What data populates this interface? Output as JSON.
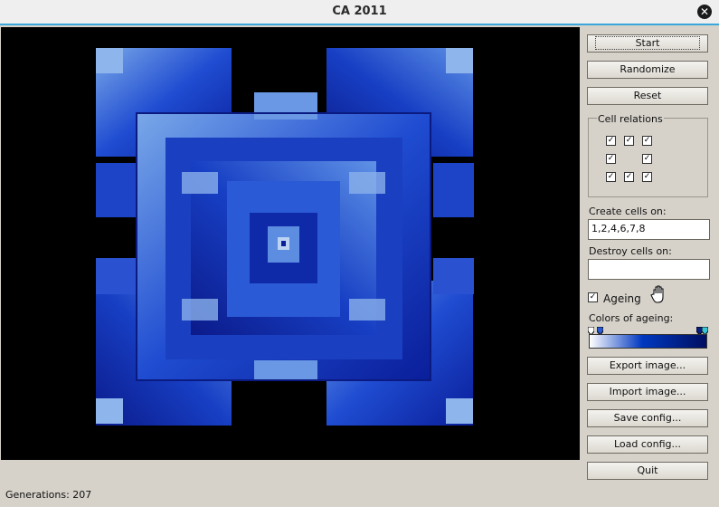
{
  "window": {
    "title": "CA 2011"
  },
  "buttons": {
    "start": "Start",
    "randomize": "Randomize",
    "reset": "Reset",
    "export_image": "Export image...",
    "import_image": "Import image...",
    "save_config": "Save config...",
    "load_config": "Load config...",
    "quit": "Quit"
  },
  "cell_relations": {
    "title": "Cell relations",
    "grid": [
      [
        true,
        true,
        true
      ],
      [
        true,
        null,
        true
      ],
      [
        true,
        true,
        true
      ]
    ]
  },
  "create_cells": {
    "label": "Create cells on:",
    "value": "1,2,4,6,7,8"
  },
  "destroy_cells": {
    "label": "Destroy cells on:",
    "value": ""
  },
  "ageing": {
    "label": "Ageing",
    "checked": true
  },
  "colors_of_ageing": {
    "label": "Colors of ageing:",
    "colors": [
      "#ffffff",
      "#0038c0",
      "#000f60"
    ]
  },
  "status": {
    "generations": "Generations: 207"
  },
  "icons": [
    "close-icon",
    "hand-cursor-icon",
    "check-icon",
    "gradient-marker-icon"
  ]
}
